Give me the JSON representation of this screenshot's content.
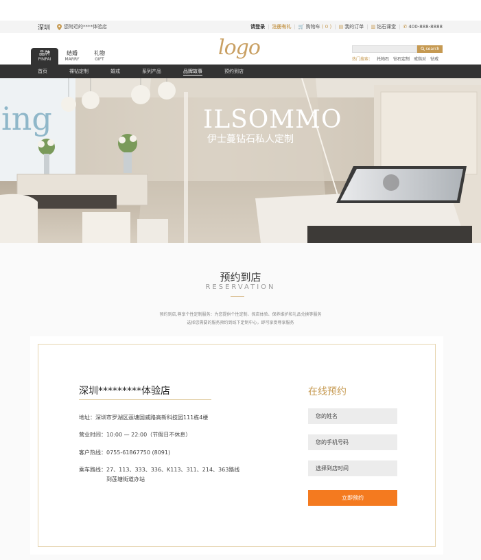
{
  "topbar": {
    "city": "深圳",
    "nearby": "您附近的****体验店",
    "login": "请登录",
    "register": "注册有礼",
    "cart_label": "购物车",
    "cart_count": "( 0 )",
    "orders": "我的订单",
    "classroom": "钻石课堂",
    "phone": "400-888-8888"
  },
  "header": {
    "logo": "logo",
    "tabs": [
      {
        "label": "品牌",
        "en": "PINPAI"
      },
      {
        "label": "结婚",
        "en": "MARRY"
      },
      {
        "label": "礼物",
        "en": "GIFT"
      }
    ],
    "search_label": "search",
    "hot_label": "热门搜索：",
    "hot_items": [
      "托帕石",
      "钻石定制",
      "戒指对",
      "钻戒"
    ]
  },
  "nav": {
    "items": [
      "首页",
      "裸钻定制",
      "婚戒",
      "系列产品",
      "品牌故事",
      "预约到店"
    ],
    "active_index": 4
  },
  "banner": {
    "sign_en": "ILSOMMO",
    "sign_cn": "伊士蔓钻石私人定制",
    "left_sign": "ing"
  },
  "section": {
    "title": "预约到店",
    "subtitle": "RESERVATION",
    "desc1": "预约到店,尊享个性定制服务：为您提供个性定制、探店体验、保养维护和礼品兑换等服务",
    "desc2": "选择您需要的服务预约到线下定制中心，即可享受尊享服务"
  },
  "store": {
    "name": "深圳*********体验店",
    "address": "地址：深圳市罗湖区莲塘国威路高新科技园111栋4楼",
    "hours": "营业时间：10:00 — 22:00（节假日不休息）",
    "hotline": "客户热线：0755-61867750 (8091)",
    "route": "乘车路线：27、113、333、336、K113、311、214、363路线",
    "route2": "到莲塘街道办站"
  },
  "form": {
    "title": "在线预约",
    "name_placeholder": "您的姓名",
    "phone_placeholder": "您的手机号码",
    "time_placeholder": "选择到店时间",
    "submit": "立即预约"
  },
  "colors": {
    "accent": "#c69a52",
    "submit": "#f47a1f",
    "nav_bg": "#333333"
  }
}
